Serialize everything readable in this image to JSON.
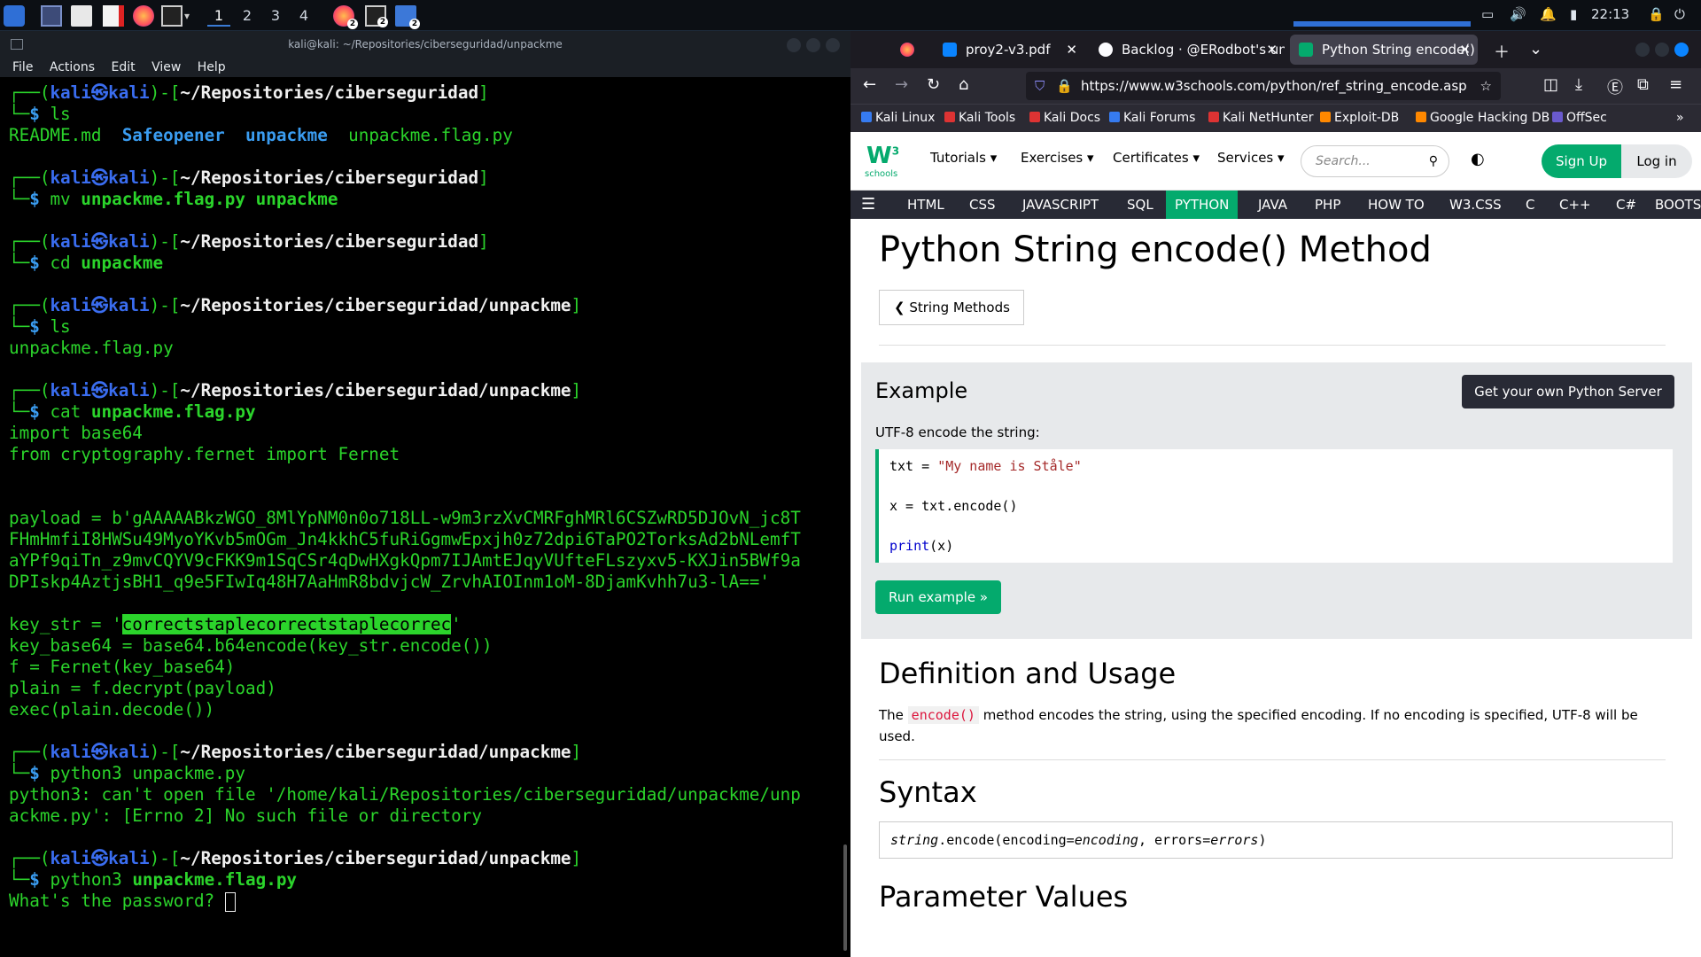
{
  "taskbar": {
    "workspaces": [
      "1",
      "2",
      "3",
      "4"
    ],
    "badges": [
      "2",
      "2",
      "2"
    ],
    "clock": "22:13"
  },
  "terminal": {
    "title": "kali@kali: ~/Repositories/ciberseguridad/unpackme",
    "menu": [
      "File",
      "Actions",
      "Edit",
      "View",
      "Help"
    ],
    "prompt_user": "kali",
    "prompt_host": "kali",
    "path_base": "~/Repositories/ciberseguridad",
    "path_sub": "~/Repositories/ciberseguridad/unpackme",
    "cmd_ls": "ls",
    "ls1": {
      "f1": "README.md",
      "d1": "Safeopener",
      "d2": "unpackme",
      "f2": "unpackme.flag.py"
    },
    "cmd_mv": "mv",
    "mv_args": "unpackme.flag.py unpackme",
    "cmd_cd": "cd",
    "cd_arg": "unpackme",
    "ls2": "unpackme.flag.py",
    "cmd_cat": "cat",
    "cat_arg": "unpackme.flag.py",
    "code_l1": "import base64",
    "code_l2": "from cryptography.fernet import Fernet",
    "payload_1": "payload = b'gAAAAABkzWGO_8MlYpNM0n0o718LL-w9m3rzXvCMRFghMRl6CSZwRD5DJOvN_jc8T",
    "payload_2": "FHmHmfiI8HWSu49MyoYKvb5mOGm_Jn4kkhC5fuRiGgmwEpxjh0z72dpi6TaPO2TorksAd2bNLemfT",
    "payload_3": "aYPf9qiTn_z9mvCQYV9cFKK9m1SqCSr4qDwHXgkQpm7IJAmtEJqyVUfteFLszyxv5-KXJin5BWf9a",
    "payload_4": "DPIskp4AztjsBH1_q9e5FIwIq48H7AaHmR8bdvjcW_ZrvhAIOInm1oM-8DjamKvhh7u3-lA=='",
    "key_pre": "key_str = '",
    "key_val": "correctstaplecorrectstaplecorrec",
    "key_post": "'",
    "code_l3": "key_base64 = base64.b64encode(key_str.encode())",
    "code_l4": "f = Fernet(key_base64)",
    "code_l5": "plain = f.decrypt(payload)",
    "code_l6": "exec(plain.decode())",
    "cmd_py": "python3",
    "py_arg1": "unpackme.py",
    "err_1": "python3: can't open file '/home/kali/Repositories/ciberseguridad/unpackme/unp",
    "err_2": "ackme.py': [Errno 2] No such file or directory",
    "py_arg2": "unpackme.flag.py",
    "pw_prompt": "What's the password? "
  },
  "browser": {
    "tabs": [
      {
        "label": "proy2-v3.pdf"
      },
      {
        "label": "Backlog · @ERodbot's un"
      },
      {
        "label": "Python String encode() M"
      }
    ],
    "url": "https://www.w3schools.com/python/ref_string_encode.asp",
    "bookmarks": [
      "Kali Linux",
      "Kali Tools",
      "Kali Docs",
      "Kali Forums",
      "Kali NetHunter",
      "Exploit-DB",
      "Google Hacking DB",
      "OffSec"
    ],
    "w3": {
      "menu": [
        "Tutorials ▾",
        "Exercises ▾",
        "Certificates ▾",
        "Services ▾"
      ],
      "search_placeholder": "Search...",
      "signup": "Sign Up",
      "login": "Log in",
      "logo_text": "schools",
      "nav": [
        "HTML",
        "CSS",
        "JAVASCRIPT",
        "SQL",
        "PYTHON",
        "JAVA",
        "PHP",
        "HOW TO",
        "W3.CSS",
        "C",
        "C++",
        "C#",
        "BOOTSTRAP"
      ]
    },
    "page": {
      "title": "Python String encode() Method",
      "back": "❮ String Methods",
      "example_heading": "Example",
      "server_button": "Get your own Python Server",
      "example_desc": "UTF-8 encode the string:",
      "code_1a": "txt = ",
      "code_1b": "\"My name is Ståle\"",
      "code_2": "x = txt.encode()",
      "code_3a": "print",
      "code_3b": "(x)",
      "run_button": "Run example »",
      "def_heading": "Definition and Usage",
      "def_pre": "The ",
      "def_code": "encode()",
      "def_post": " method encodes the string, using the specified encoding. If no encoding is specified, UTF-8 will be used.",
      "syntax_heading": "Syntax",
      "syntax_a": "string",
      "syntax_b": ".encode(encoding=",
      "syntax_c": "encoding",
      "syntax_d": ", errors=",
      "syntax_e": "errors",
      "syntax_f": ")",
      "param_heading": "Parameter Values"
    }
  }
}
